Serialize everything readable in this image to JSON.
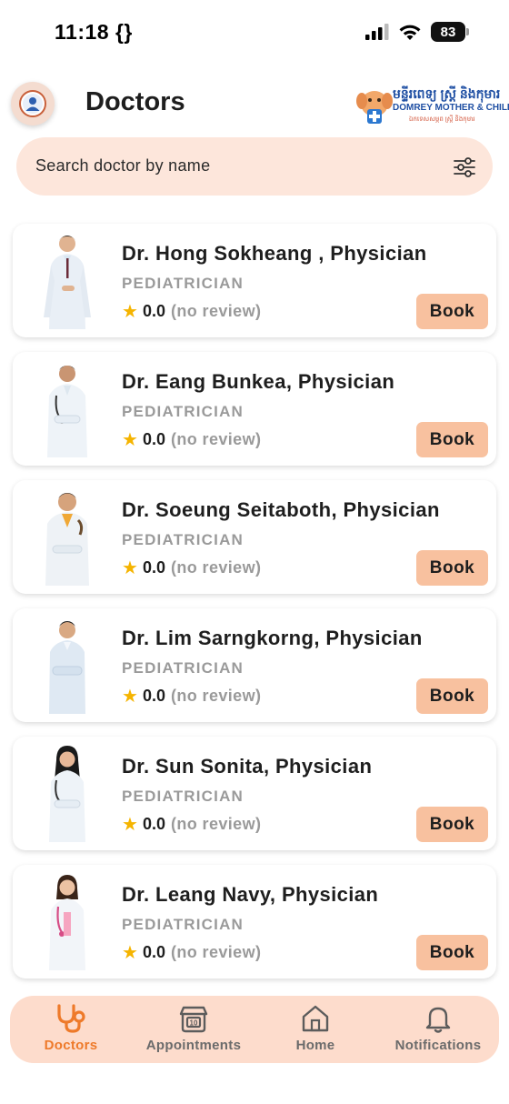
{
  "status_bar": {
    "time": "11:18 {}",
    "battery": "83"
  },
  "header": {
    "title": "Doctors",
    "logo": {
      "khmer": "មន្ទីរពេទ្យ ស្ត្រី និងកុមារ",
      "english": "DOMREY MOTHER & CHILD CLINIC",
      "sub": "ឯកទេសសម្ភព ស្ត្រី និងកុមារ"
    }
  },
  "search": {
    "placeholder": "Search doctor by name"
  },
  "doctors": [
    {
      "name": "Dr. Hong Sokheang , Physician",
      "specialty": "PEDIATRICIAN",
      "rating": "0.0",
      "reviews": "(no review)",
      "book_label": "Book"
    },
    {
      "name": "Dr. Eang Bunkea, Physician",
      "specialty": "PEDIATRICIAN",
      "rating": "0.0",
      "reviews": "(no review)",
      "book_label": "Book"
    },
    {
      "name": "Dr. Soeung Seitaboth, Physician",
      "specialty": "PEDIATRICIAN",
      "rating": "0.0",
      "reviews": "(no review)",
      "book_label": "Book"
    },
    {
      "name": "Dr. Lim Sarngkorng, Physician",
      "specialty": "PEDIATRICIAN",
      "rating": "0.0",
      "reviews": "(no review)",
      "book_label": "Book"
    },
    {
      "name": "Dr. Sun Sonita, Physician",
      "specialty": "PEDIATRICIAN",
      "rating": "0.0",
      "reviews": "(no review)",
      "book_label": "Book"
    },
    {
      "name": "Dr. Leang Navy, Physician",
      "specialty": "PEDIATRICIAN",
      "rating": "0.0",
      "reviews": "(no review)",
      "book_label": "Book"
    }
  ],
  "bottom_nav": {
    "items": [
      {
        "label": "Doctors",
        "icon": "stethoscope-icon",
        "active": true
      },
      {
        "label": "Appointments",
        "icon": "calendar-icon",
        "active": false
      },
      {
        "label": "Home",
        "icon": "home-icon",
        "active": false
      },
      {
        "label": "Notifications",
        "icon": "bell-icon",
        "active": false
      }
    ]
  },
  "colors": {
    "accent": "#ee7a2a",
    "book_button": "#f8c19f",
    "search_bg": "#fde6db",
    "nav_bg": "#fddccc",
    "star": "#f5b400"
  }
}
